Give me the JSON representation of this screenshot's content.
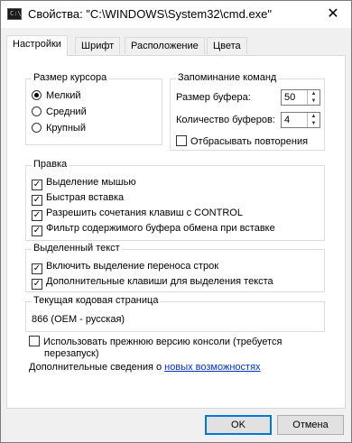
{
  "window": {
    "title": "Свойства: \"C:\\WINDOWS\\System32\\cmd.exe\"",
    "close_glyph": "✕"
  },
  "tabs": [
    {
      "label": "Настройки"
    },
    {
      "label": "Шрифт"
    },
    {
      "label": "Расположение"
    },
    {
      "label": "Цвета"
    }
  ],
  "cursor_size": {
    "title": "Размер курсора",
    "options": [
      {
        "label": "Мелкий",
        "selected": true
      },
      {
        "label": "Средний",
        "selected": false
      },
      {
        "label": "Крупный",
        "selected": false
      }
    ]
  },
  "command_history": {
    "title": "Запоминание команд",
    "buffer_size_label": "Размер буфера:",
    "buffer_size_value": "50",
    "buffer_count_label": "Количество буферов:",
    "buffer_count_value": "4",
    "discard_duplicates_label": "Отбрасывать повторения",
    "discard_duplicates_checked": false
  },
  "edit": {
    "title": "Правка",
    "options": [
      {
        "label": "Выделение мышью",
        "checked": true
      },
      {
        "label": "Быстрая вставка",
        "checked": true
      },
      {
        "label": "Разрешить сочетания клавиш с CONTROL",
        "checked": true
      },
      {
        "label": "Фильтр содержимого буфера обмена при вставке",
        "checked": true
      }
    ]
  },
  "selected_text": {
    "title": "Выделенный текст",
    "options": [
      {
        "label": "Включить выделение переноса строк",
        "checked": true
      },
      {
        "label": "Дополнительные клавиши для выделения текста",
        "checked": true
      }
    ]
  },
  "codepage": {
    "title": "Текущая кодовая страница",
    "value": "866   (OEM - русская)"
  },
  "legacy": {
    "label_line1": "Использовать прежнюю версию консоли (требуется",
    "label_line2": "перезапуск)",
    "checked": false
  },
  "more_info": {
    "prefix": "Дополнительные сведения о ",
    "link": "новых возможностях"
  },
  "buttons": {
    "ok": "OK",
    "cancel": "Отмена"
  }
}
